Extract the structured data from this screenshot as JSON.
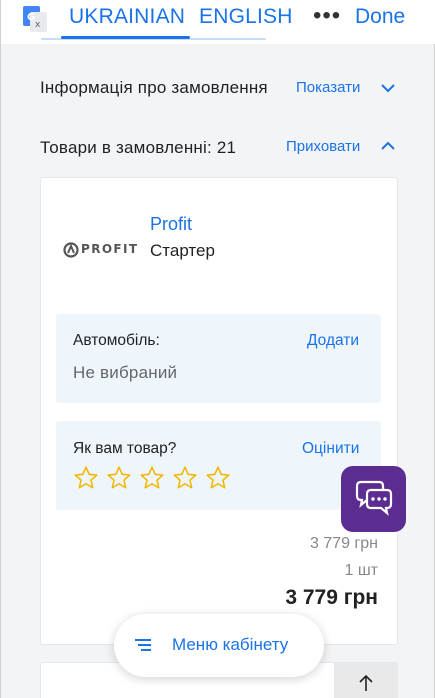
{
  "translate_bar": {
    "source_lang": "UKRAINIAN",
    "target_lang": "ENGLISH",
    "more": "•••",
    "done": "Done"
  },
  "order_info": {
    "label": "Інформація про замовлення",
    "toggle": "Показати"
  },
  "order_items": {
    "label": "Товари в замовленні: 21",
    "toggle": "Приховати"
  },
  "product": {
    "logo_text": "PROFIT",
    "brand": "Profit",
    "name": "Стартер",
    "car": {
      "label": "Автомобіль:",
      "action": "Додати",
      "value": "Не вибраний"
    },
    "rating": {
      "label": "Як вам товар?",
      "action": "Оцінити",
      "stars_total": 5,
      "stars_filled": 0
    },
    "unit_price": "3 779 грн",
    "quantity": "1 шт",
    "total": "3 779 грн"
  },
  "cabinet_menu": {
    "label": "Меню кабінету"
  },
  "icons": {
    "translate": "google-translate-icon",
    "chat": "chat-bubbles-icon",
    "menu": "menu-lines-icon",
    "scroll_top": "arrow-up-icon"
  },
  "colors": {
    "accent": "#1a73e8",
    "chat_button": "#5c2d91",
    "star": "#f2b600",
    "panel_bg": "#eef5fb"
  }
}
